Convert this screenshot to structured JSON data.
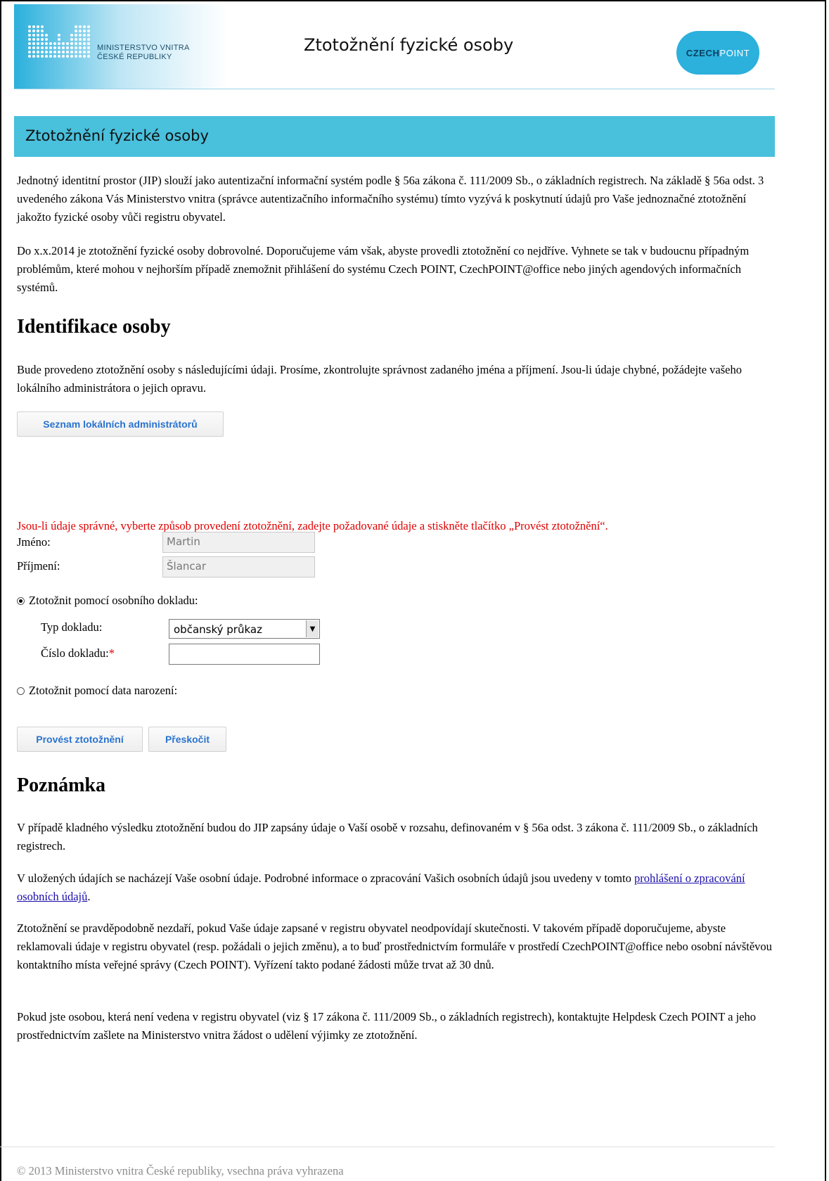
{
  "header": {
    "ministry_line1": "MINISTERSTVO VNITRA",
    "ministry_line2": "ČESKÉ REPUBLIKY",
    "title": "Ztotožnění fyzické osoby",
    "czechpoint_logo_a": "CZECH",
    "czechpoint_logo_b": "POINT"
  },
  "section_title": "Ztotožnění fyzické osoby",
  "intro": {
    "p1": "Jednotný identitní prostor (JIP) slouží jako autentizační informační systém podle § 56a zákona č. 111/2009 Sb., o základních registrech. Na základě § 56a odst. 3 uvedeného zákona Vás Ministerstvo vnitra (správce autentizačního informačního systému) tímto vyzývá k poskytnutí údajů pro Vaše jednoznačné ztotožnění jakožto fyzické osoby vůči registru obyvatel.",
    "p2": "Do x.x.2014 je ztotožnění fyzické osoby dobrovolné. Doporučujeme vám však, abyste provedli ztotožnění co nejdříve. Vyhnete se tak v budoucnu případným problémům, které mohou v nejhorším případě znemožnit přihlášení do systému Czech POINT, CzechPOINT@office nebo jiných agendových informačních systémů."
  },
  "identification": {
    "heading": "Identifikace osoby",
    "text": "Bude provedeno ztotožnění osoby s následujícími údaji. Prosíme, zkontrolujte správnost zadaného jména a příjmení. Jsou-li údaje chybné, požádejte vašeho lokálního administrátora o jejich opravu.",
    "admins_button": "Seznam lokálních administrátorů"
  },
  "form": {
    "instruction": "Jsou-li údaje správné, vyberte způsob provedení ztotožnění, zadejte požadované údaje a stiskněte tlačítko „Provést ztotožnění“.",
    "first_name_label": "Jméno:",
    "first_name_value": "Martin",
    "last_name_label": "Příjmení:",
    "last_name_value": "Šlancar",
    "option_document": "Ztotožnit pomocí osobního dokladu:",
    "option_document_selected": true,
    "doc_type_label": "Typ dokladu:",
    "doc_type_value": "občanský průkaz",
    "doc_number_label": "Číslo dokladu:",
    "required_mark": "*",
    "doc_number_value": "",
    "option_birthdate": "Ztotožnit pomocí data narození:",
    "option_birthdate_selected": false,
    "submit_button": "Provést ztotožnění",
    "skip_button": "Přeskočit"
  },
  "note": {
    "heading": "Poznámka",
    "p1": "V případě kladného výsledku ztotožnění budou do JIP zapsány údaje o Vaší osobě v rozsahu, definovaném v § 56a odst. 3 zákona č. 111/2009 Sb., o základních registrech.",
    "p2_before": "V uložených údajích se nacházejí Vaše osobní údaje. Podrobné informace o zpracování Vašich osobních údajů jsou uvedeny v tomto ",
    "p2_link": "prohlášení o zpracování osobních údajů",
    "p2_after": ".",
    "p3": "Ztotožnění se pravděpodobně nezdaří, pokud Vaše údaje zapsané v registru obyvatel neodpovídají skutečnosti. V takovém případě doporučujeme, abyste reklamovali údaje v registru obyvatel (resp. požádali o jejich změnu), a to buď prostřednictvím formuláře v prostředí CzechPOINT@office nebo osobní návštěvou kontaktního místa veřejné správy (Czech POINT). Vyřízení takto podané žádosti může trvat až 30 dnů.",
    "p4": "Pokud jste osobou, která není vedena v registru obyvatel (viz § 17 zákona č. 111/2009 Sb., o základních registrech), kontaktujte Helpdesk Czech POINT a jeho prostřednictvím zašlete na Ministerstvo vnitra žádost o udělení výjimky ze ztotožnění."
  },
  "footer": "© 2013 Ministerstvo vnitra České republiky, vsechna práva vyhrazena",
  "colors": {
    "accent": "#49c0dc",
    "warning_text": "#e00000",
    "button_text": "#2a73cf"
  }
}
